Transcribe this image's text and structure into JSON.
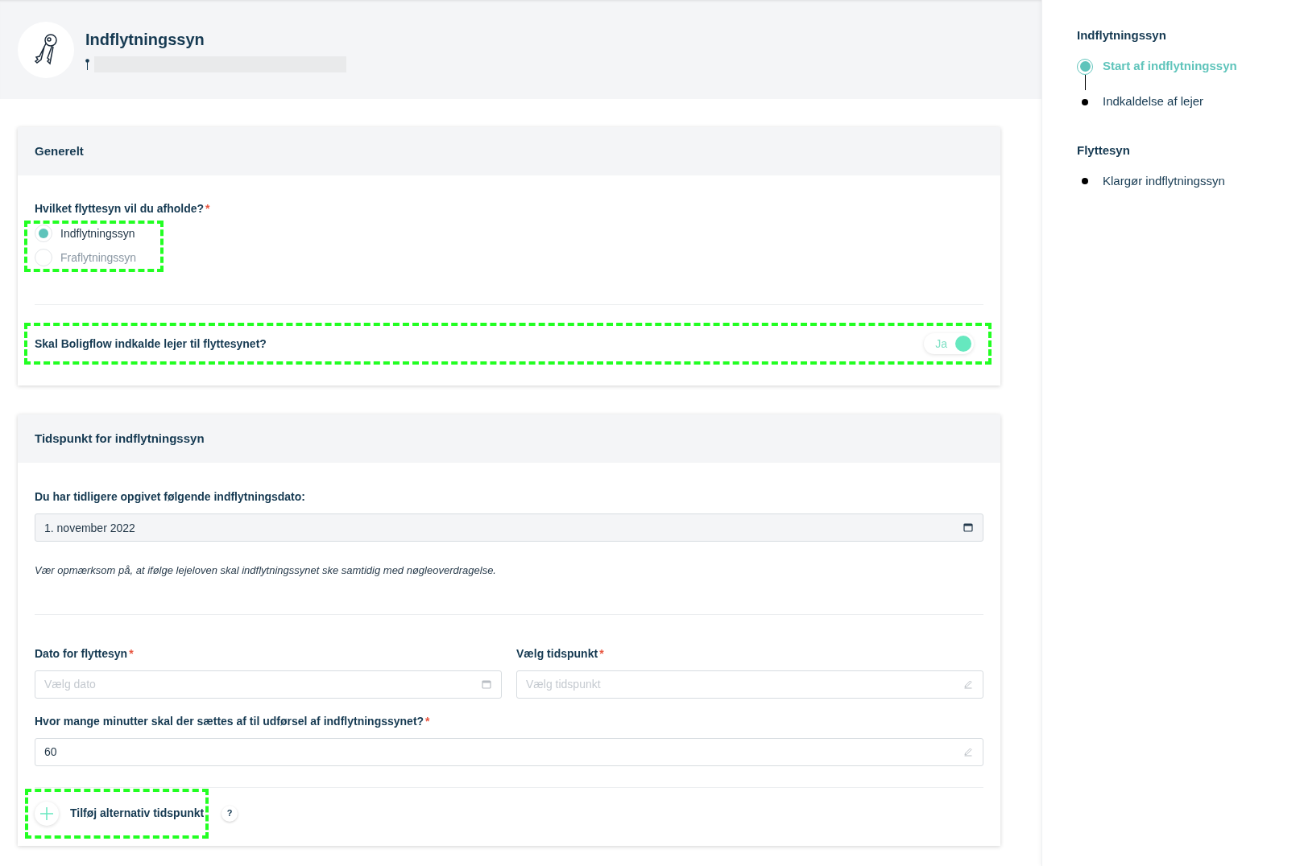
{
  "header": {
    "title": "Indflytningssyn"
  },
  "general": {
    "title": "Generelt",
    "question": {
      "text": "Hvilket flyttesyn vil du afholde?",
      "required_mark": "*"
    },
    "options": [
      {
        "label": "Indflytningssyn",
        "selected": true
      },
      {
        "label": "Fraflytningssyn",
        "selected": false
      }
    ],
    "summon": {
      "text": "Skal Boligflow indkalde lejer til flyttesynet?",
      "toggle": {
        "label": "Ja",
        "on": true
      }
    }
  },
  "timing": {
    "title": "Tidspunkt for indflytningssyn",
    "previous_date": {
      "label": "Du har tidligere opgivet følgende indflytningsdato:",
      "value": "1. november 2022"
    },
    "note": "Vær opmærksom på, at ifølge lejeloven skal indflytningssynet ske samtidig med nøgleoverdragelse.",
    "date_field": {
      "label": "Dato for flyttesyn",
      "required_mark": "*",
      "placeholder": "Vælg dato"
    },
    "time_field": {
      "label": "Vælg tidspunkt",
      "required_mark": "*",
      "placeholder": "Vælg tidspunkt"
    },
    "minutes_field": {
      "label": "Hvor mange minutter skal der sættes af til udførsel af indflytningssynet?",
      "required_mark": "*",
      "value": "60"
    },
    "add_button": {
      "label": "Tilføj alternativ tidspunkt",
      "help": "?"
    }
  },
  "steps": [
    {
      "title": "Indflytningssyn",
      "items": [
        {
          "label": "Start af indflytningssyn",
          "selected": true
        },
        {
          "label": "Indkaldelse af lejer",
          "selected": false
        }
      ]
    },
    {
      "title": "Flyttesyn",
      "items": [
        {
          "label": "Klargør indflytningssyn",
          "selected": false
        }
      ]
    }
  ]
}
